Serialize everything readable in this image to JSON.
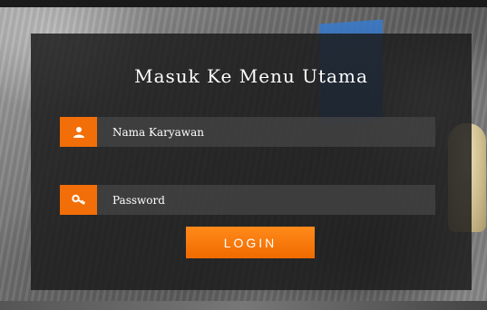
{
  "form": {
    "title": "Masuk Ke Menu Utama",
    "username": {
      "placeholder": "Nama Karyawan",
      "value": "",
      "icon": "user-icon"
    },
    "password": {
      "placeholder": "Password",
      "value": "",
      "icon": "key-icon"
    },
    "login_label": "LOGIN"
  },
  "colors": {
    "accent": "#f26e08",
    "panel": "#1c1c1c",
    "text": "#ffffff"
  }
}
